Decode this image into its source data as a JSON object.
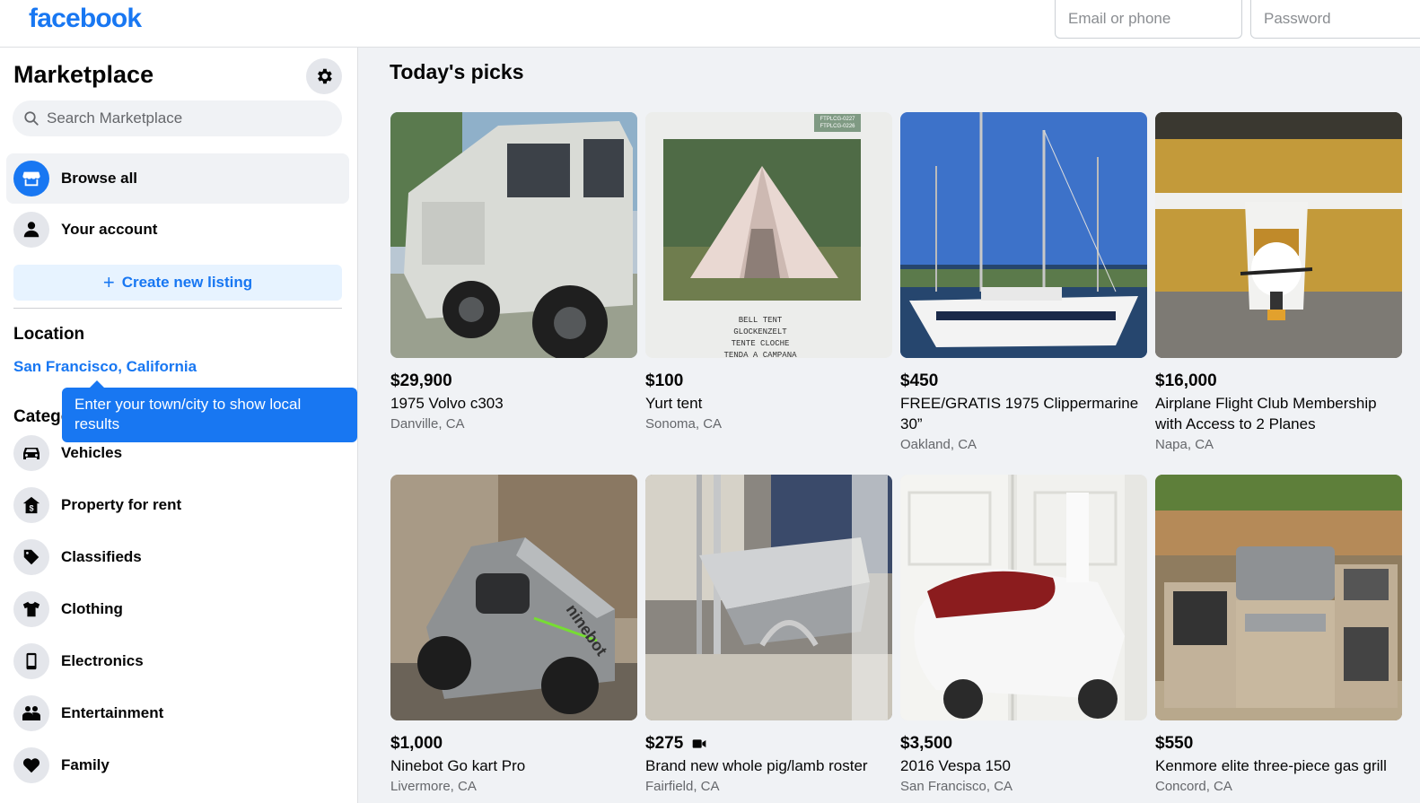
{
  "header": {
    "logo": "facebook",
    "email_placeholder": "Email or phone",
    "password_placeholder": "Password"
  },
  "sidebar": {
    "title": "Marketplace",
    "search_placeholder": "Search Marketplace",
    "nav": [
      {
        "label": "Browse all",
        "icon": "storefront-icon",
        "active": true
      },
      {
        "label": "Your account",
        "icon": "person-icon",
        "active": false
      }
    ],
    "create_listing": "Create new listing",
    "location_heading": "Location",
    "location_value": "San Francisco, California",
    "tooltip": "Enter your town/city to show local results",
    "categories_heading": "Categories",
    "categories": [
      {
        "label": "Vehicles",
        "icon": "car-icon"
      },
      {
        "label": "Property for rent",
        "icon": "house-dollar-icon"
      },
      {
        "label": "Classifieds",
        "icon": "tag-icon"
      },
      {
        "label": "Clothing",
        "icon": "shirt-icon"
      },
      {
        "label": "Electronics",
        "icon": "phone-icon"
      },
      {
        "label": "Entertainment",
        "icon": "people-icon"
      },
      {
        "label": "Family",
        "icon": "heart-icon"
      }
    ]
  },
  "main": {
    "section_title": "Today's picks",
    "listings": [
      {
        "price": "$29,900",
        "title": "1975 Volvo c303",
        "city": "Danville, CA",
        "image": "jeep-photo"
      },
      {
        "price": "$100",
        "title": "Yurt tent",
        "city": "Sonoma, CA",
        "image": "tent-photo"
      },
      {
        "price": "$450",
        "title": "FREE/GRATIS 1975 Clippermarine 30”",
        "city": "Oakland, CA",
        "image": "sailboat-photo"
      },
      {
        "price": "$16,000",
        "title": "Airplane Flight Club Membership with Access to 2 Planes",
        "city": "Napa, CA",
        "image": "airplane-photo"
      },
      {
        "price": "$1,000",
        "title": "Ninebot Go kart Pro",
        "city": "Livermore, CA",
        "image": "gokart-photo"
      },
      {
        "price": "$275",
        "title": "Brand new whole pig/lamb roster",
        "city": "Fairfield, CA",
        "image": "roaster-photo",
        "video": true
      },
      {
        "price": "$3,500",
        "title": "2016 Vespa 150",
        "city": "San Francisco, CA",
        "image": "vespa-photo"
      },
      {
        "price": "$550",
        "title": "Kenmore elite three-piece gas grill",
        "city": "Concord, CA",
        "image": "grill-photo"
      }
    ],
    "tent_print": [
      "BELL TENT",
      "GLOCKENZELT",
      "TENTE CLOCHE",
      "TENDA A CAMPANA"
    ],
    "tent_codes": [
      "FTPLCG-0227",
      "FTPLCG-0226"
    ],
    "gokart_brand": "ninebot"
  },
  "colors": {
    "brand": "#1877f2",
    "page_bg": "#f0f2f5",
    "secondary_text": "#65676b"
  }
}
